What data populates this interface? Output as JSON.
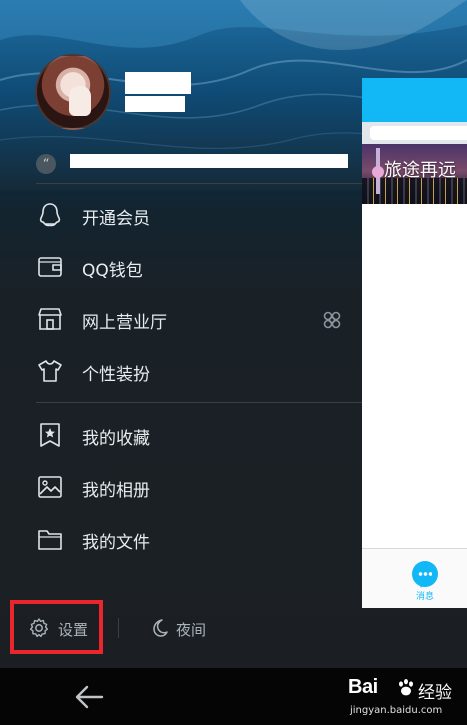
{
  "profile": {
    "avatar": "user-avatar"
  },
  "menu": {
    "items": [
      {
        "label": "开通会员",
        "icon": "penguin-icon"
      },
      {
        "label": "QQ钱包",
        "icon": "wallet-icon"
      },
      {
        "label": "网上营业厅",
        "icon": "storefront-icon",
        "trail_icon": "unicom-knot-icon"
      },
      {
        "label": "个性装扮",
        "icon": "tshirt-icon"
      },
      {
        "label": "我的收藏",
        "icon": "bookmark-star-icon"
      },
      {
        "label": "我的相册",
        "icon": "image-icon"
      },
      {
        "label": "我的文件",
        "icon": "folder-icon"
      }
    ]
  },
  "bottom": {
    "settings_label": "设置",
    "night_label": "夜间"
  },
  "main_peek": {
    "banner_title": "旅途再远",
    "tab_messages": "消息"
  },
  "watermark": {
    "brand": "Bai",
    "cn": "经验",
    "url": "jingyan.baidu.com"
  },
  "colors": {
    "accent_blue": "#12b7f5",
    "highlight_red": "#e8262b",
    "drawer_bg": "#1b1f23",
    "menu_text": "#e8ecef"
  }
}
